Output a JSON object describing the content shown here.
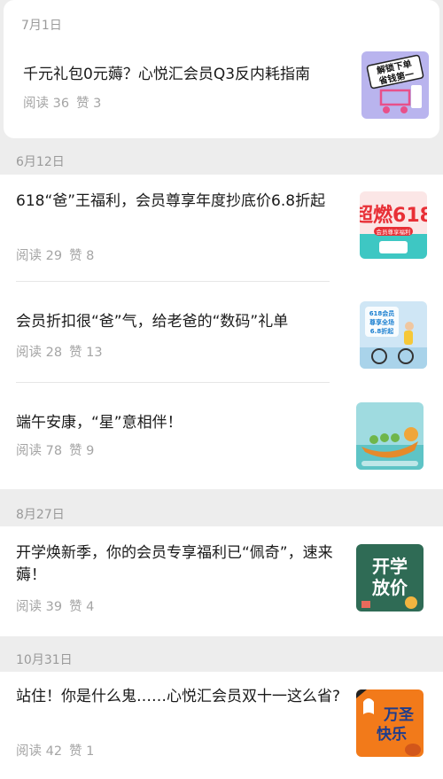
{
  "sections": [
    {
      "date": "7月1日",
      "articles": [
        {
          "title": "千元礼包0元薅？心悦汇会员Q3反内耗指南",
          "reads": "阅读 36",
          "likes": "赞 3",
          "thumb_text": "解锁下单 省钱第一"
        }
      ]
    },
    {
      "date": "6月12日",
      "articles": [
        {
          "title": "618“爸”王福利，会员尊享年度抄底价6.8折起",
          "reads": "阅读 29",
          "likes": "赞 8",
          "thumb_text": "超燃618",
          "thumb_sub": "会员尊享福利"
        },
        {
          "title": "会员折扣很“爸”气，给老爸的“数码”礼单",
          "reads": "阅读 28",
          "likes": "赞 13",
          "thumb_text": "618会员 尊享全场 6.8折起"
        },
        {
          "title": "端午安康，“星”意相伴！",
          "reads": "阅读 78",
          "likes": "赞 9"
        }
      ]
    },
    {
      "date": "8月27日",
      "articles": [
        {
          "title": "开学焕新季，你的会员专享福利已“佩奇”，速来薅！",
          "reads": "阅读 39",
          "likes": "赞 4",
          "thumb_text": "开学",
          "thumb_text2": "放价"
        }
      ]
    },
    {
      "date": "10月31日",
      "articles": [
        {
          "title": "站住！你是什么鬼……心悦汇会员双十一这么省?",
          "reads": "阅读 42",
          "likes": "赞 1",
          "thumb_text": "万圣",
          "thumb_text2": "快乐"
        }
      ]
    }
  ],
  "colors": {
    "background": "#ededed",
    "card": "#ffffff",
    "title": "#1a1a1a",
    "meta": "#a5a5a5",
    "date": "#9a9a9a"
  }
}
